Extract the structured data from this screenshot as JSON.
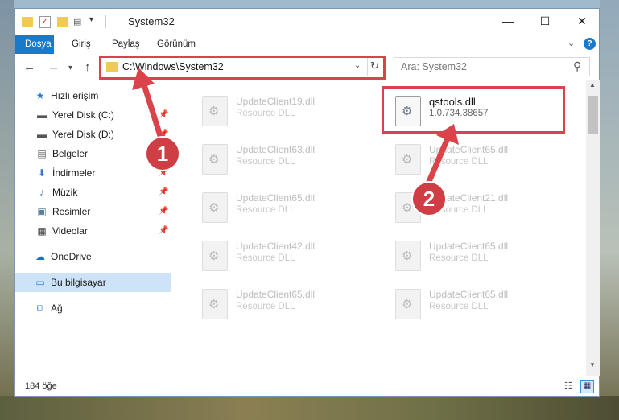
{
  "window": {
    "title": "System32"
  },
  "ribbon": {
    "tabs": [
      "Dosya",
      "Giriş",
      "Paylaş",
      "Görünüm"
    ]
  },
  "address": {
    "path": "C:\\Windows\\System32"
  },
  "search": {
    "placeholder": "Ara: System32"
  },
  "sidebar": {
    "items": [
      {
        "label": "Hızlı erişim",
        "icon": "star-icon",
        "pinned": false
      },
      {
        "label": "Yerel Disk (C:)",
        "icon": "drive-icon",
        "pinned": true
      },
      {
        "label": "Yerel Disk (D:)",
        "icon": "drive-icon",
        "pinned": true
      },
      {
        "label": "Belgeler",
        "icon": "documents-icon",
        "pinned": true
      },
      {
        "label": "İndirmeler",
        "icon": "downloads-icon",
        "pinned": true
      },
      {
        "label": "Müzik",
        "icon": "music-icon",
        "pinned": true
      },
      {
        "label": "Resimler",
        "icon": "pictures-icon",
        "pinned": true
      },
      {
        "label": "Videolar",
        "icon": "videos-icon",
        "pinned": true
      },
      {
        "label": "OneDrive",
        "icon": "cloud-icon",
        "pinned": false
      },
      {
        "label": "Bu bilgisayar",
        "icon": "computer-icon",
        "pinned": false,
        "selected": true
      },
      {
        "label": "Ağ",
        "icon": "network-icon",
        "pinned": false
      }
    ]
  },
  "files": [
    {
      "name": "UpdateClient19.dll",
      "sub": "Resource DLL"
    },
    {
      "name": "qstools.dll",
      "sub": "1.0.734.38657",
      "highlighted": true
    },
    {
      "name": "UpdateClient63.dll",
      "sub": "Resource DLL"
    },
    {
      "name": "UpdateClient65.dll",
      "sub": "Resource DLL"
    },
    {
      "name": "UpdateClient65.dll",
      "sub": "Resource DLL"
    },
    {
      "name": "UpdateClient21.dll",
      "sub": "Resource DLL"
    },
    {
      "name": "UpdateClient42.dll",
      "sub": "Resource DLL"
    },
    {
      "name": "UpdateClient65.dll",
      "sub": "Resource DLL"
    },
    {
      "name": "UpdateClient65.dll",
      "sub": "Resource DLL"
    },
    {
      "name": "UpdateClient65.dll",
      "sub": "Resource DLL"
    }
  ],
  "status": {
    "count": "184 öğe"
  },
  "annotations": {
    "step1": "1",
    "step2": "2",
    "color": "#d94349"
  }
}
